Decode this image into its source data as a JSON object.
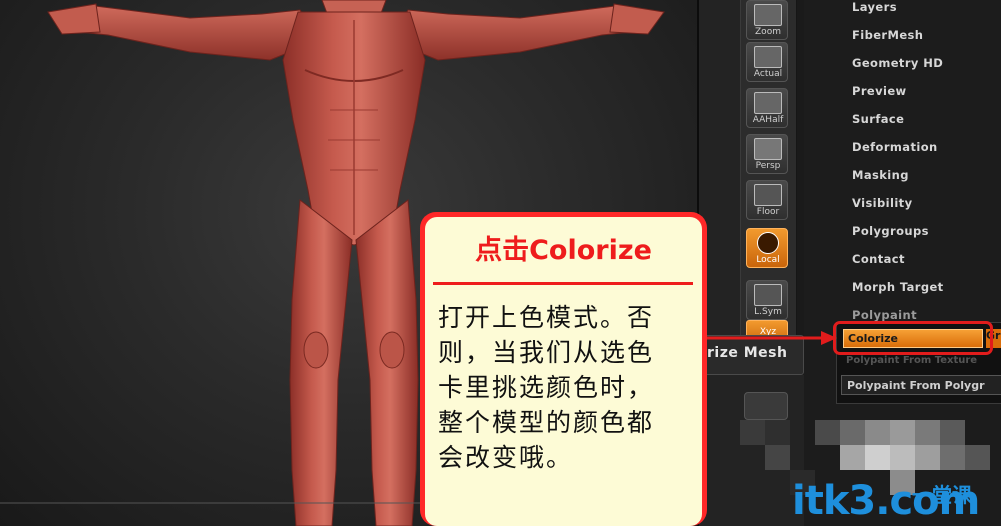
{
  "shelf": {
    "buttons": [
      {
        "label": "Zoom",
        "icon": "zoom-icon"
      },
      {
        "label": "Actual",
        "icon": "actual-size-icon"
      },
      {
        "label": "AAHalf",
        "icon": "aahalf-icon"
      },
      {
        "label": "Persp",
        "icon": "perspective-grid-icon"
      },
      {
        "label": "Floor",
        "icon": "floor-icon"
      },
      {
        "label": "Local",
        "icon": "local-rotate-icon",
        "active": true
      },
      {
        "label": "L.Sym",
        "icon": "local-symmetry-icon"
      },
      {
        "label": "Xyz",
        "icon": "xyz-axis-icon"
      }
    ],
    "flyout_text": "rize Mesh"
  },
  "menu": {
    "items": [
      "Layers",
      "FiberMesh",
      "Geometry HD",
      "Preview",
      "Surface",
      "Deformation",
      "Masking",
      "Visibility",
      "Polygroups",
      "Contact",
      "Morph Target",
      "Polypaint"
    ],
    "colorize_label": "Colorize",
    "grd_label": "Gr",
    "ghost_label": "Polypaint From Texture",
    "polypaint_from_polygroups": "Polypaint From Polygr"
  },
  "callout": {
    "title": "点击Colorize",
    "body": "打开上色模式。否则，当我们从选色卡里挑选颜色时，整个模型的颜色都会改变哦。"
  },
  "watermark": {
    "brand": "itk3",
    "cn": "一堂课",
    "domain": ".com"
  },
  "colors": {
    "accent_orange": "#e87f17",
    "highlight_red": "#e11c1c",
    "callout_bg": "#fdfbd6",
    "model_skin": "#b5463c",
    "watermark_blue": "#1e8fdc"
  }
}
